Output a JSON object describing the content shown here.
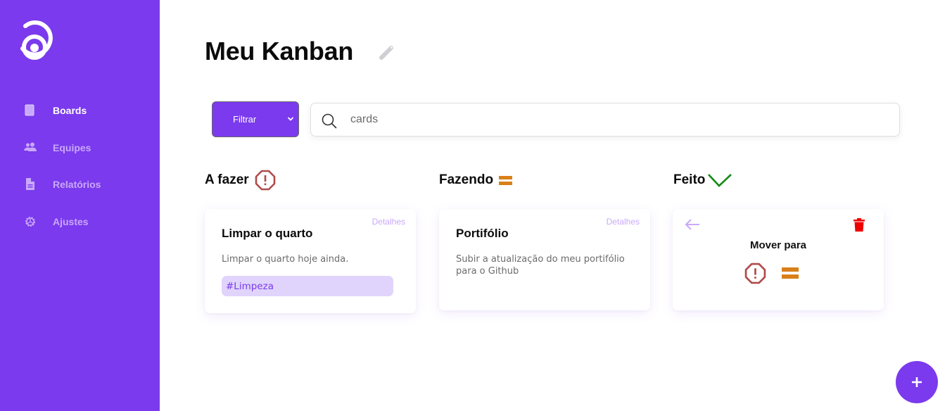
{
  "sidebar": {
    "logo": "concentric-rings-logo",
    "items": [
      {
        "label": "Boards",
        "icon": "board-icon",
        "active": true
      },
      {
        "label": "Equipes",
        "icon": "users-icon",
        "active": false
      },
      {
        "label": "Relatórios",
        "icon": "document-icon",
        "active": false
      },
      {
        "label": "Ajustes",
        "icon": "gear-icon",
        "active": false
      }
    ]
  },
  "header": {
    "title": "Meu Kanban",
    "edit_icon": "pencil-icon"
  },
  "toolbar": {
    "filter_label": "Filtrar",
    "search": {
      "value": "",
      "placeholder": "cards"
    }
  },
  "columns": [
    {
      "title": "A fazer",
      "icon": "octagon-alert-icon",
      "icon_color": "#b04a4a"
    },
    {
      "title": "Fazendo",
      "icon": "equals-icon",
      "icon_color": "#d98019"
    },
    {
      "title": "Feito",
      "icon": "check-icon",
      "icon_color": "#138a13"
    }
  ],
  "cards": [
    {
      "column": "A fazer",
      "details_label": "Detalhes",
      "title": "Limpar o quarto",
      "description": "Limpar o quarto hoje ainda.",
      "tag": "#Limpeza"
    },
    {
      "column": "Fazendo",
      "details_label": "Detalhes",
      "title": "Portifólio",
      "description": "Subir a atualização do meu portifólio para o Github"
    }
  ],
  "move_card": {
    "column": "Feito",
    "label": "Mover para",
    "targets": [
      "A fazer",
      "Fazendo"
    ]
  },
  "fab": {
    "icon": "plus-icon"
  },
  "colors": {
    "brand": "#7b3aed",
    "nav_inactive": "#c9a8fb",
    "tag_bg": "#e0d4fc",
    "delete": "#ee0000"
  }
}
